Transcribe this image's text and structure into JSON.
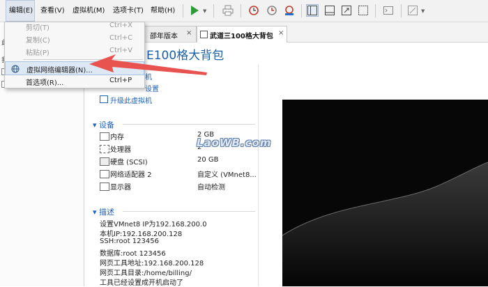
{
  "menubar": {
    "items": [
      "编辑(E)",
      "查看(V)",
      "虚拟机(M)",
      "选项卡(T)",
      "帮助(H)"
    ]
  },
  "toolbar": {
    "icons": [
      "play-icon",
      "print-icon",
      "snapshot-icon",
      "snapshot-revert-icon",
      "snapshot-manager-icon",
      "view-sidebar-icon",
      "view-console-icon",
      "view-fullscreen-icon",
      "terminal-icon",
      "unity-icon"
    ]
  },
  "tabs": [
    {
      "label": "邵年版本",
      "close": "×"
    },
    {
      "label": "武道三100格大背包",
      "close": "×"
    }
  ],
  "vm": {
    "title_fragment": "E100格大背包",
    "actions": [
      "机",
      "设置",
      "升级此虚拟机"
    ]
  },
  "devices": {
    "header": "设备",
    "items": [
      {
        "name": "内存",
        "value": "2 GB",
        "icon": "memory-icon"
      },
      {
        "name": "处理器",
        "value": "2",
        "icon": "cpu-icon"
      },
      {
        "name": "硬盘 (SCSI)",
        "value": "20 GB",
        "icon": "disk-icon"
      },
      {
        "name": "网络适配器 2",
        "value": "自定义 (VMnet8...",
        "icon": "network-icon"
      },
      {
        "name": "显示器",
        "value": "自动检测",
        "icon": "display-icon"
      }
    ]
  },
  "description": {
    "header": "描述",
    "lines": [
      "设置VMnet8 IP为192.168.200.0",
      "本机IP:192.168.200.128",
      "SSH:root 123456",
      "数据库:root 123456",
      "网页工具地址:192.168.200.128",
      "网页工具目录:/home/billing/",
      "工具已经设置成开机启动了"
    ]
  },
  "edit_menu": {
    "items": [
      {
        "label": "剪切(T)",
        "shortcut": "Ctrl+X",
        "enabled": false
      },
      {
        "label": "复制(C)",
        "shortcut": "Ctrl+C",
        "enabled": false
      },
      {
        "label": "粘贴(P)",
        "shortcut": "Ctrl+V",
        "enabled": false
      },
      {
        "label": "虚拟网络编辑器(N)...",
        "shortcut": "",
        "enabled": true,
        "highlighted": true,
        "icon": "network-globe-icon"
      },
      {
        "label": "首选项(R)...",
        "shortcut": "Ctrl+P",
        "enabled": true
      }
    ]
  },
  "watermark": "LaoWB.com",
  "colors": {
    "accent": "#2062b8",
    "arrow": "#e8524f",
    "highlight": "#dde8f5"
  }
}
